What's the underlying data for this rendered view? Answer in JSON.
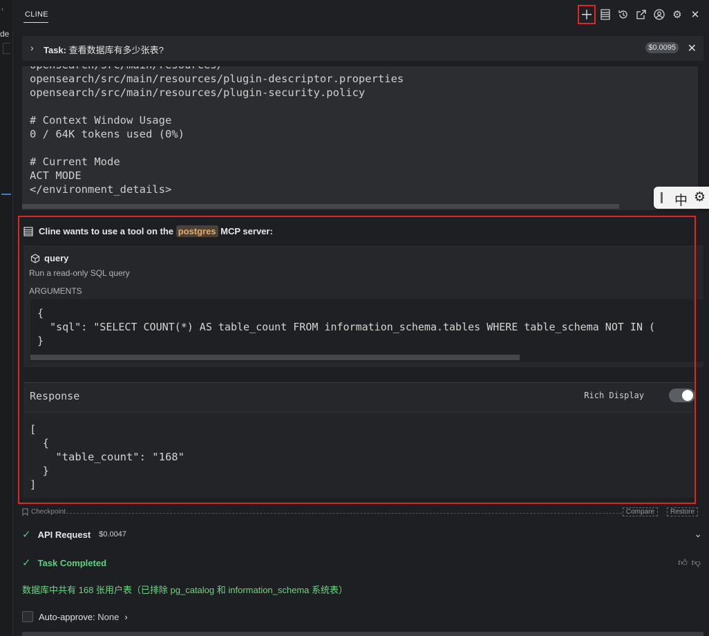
{
  "left_fragment": "de",
  "header": {
    "tab_title": "CLINE",
    "icons": [
      "plus-icon",
      "server-list-icon",
      "history-icon",
      "popout-icon",
      "account-icon",
      "gear-icon",
      "close-icon"
    ]
  },
  "task": {
    "prefix": "Task:",
    "text": "查看数据库有多少张表?",
    "cost": "$0.0095"
  },
  "environment_text": "opensearch/src/main/resources/\nopensearch/src/main/resources/plugin-descriptor.properties\nopensearch/src/main/resources/plugin-security.policy\n\n# Context Window Usage\n0 / 64K tokens used (0%)\n\n# Current Mode\nACT MODE\n</environment_details>",
  "ime": {
    "label": "中"
  },
  "tool": {
    "header_prefix": "Cline wants to use a tool on the",
    "server": "postgres",
    "header_suffix": "MCP server:",
    "name": "query",
    "description": "Run a read-only SQL query",
    "arguments_label": "ARGUMENTS",
    "arguments_code": "{\n  \"sql\": \"SELECT COUNT(*) AS table_count FROM information_schema.tables WHERE table_schema NOT IN (\n}",
    "response_title": "Response",
    "rich_display_label": "Rich Display",
    "rich_display_on": true,
    "response_code": "[\n  {\n    \"table_count\": \"168\"\n  }\n]"
  },
  "checkpoint": {
    "label": "Checkpoint",
    "compare": "Compare",
    "restore": "Restore"
  },
  "api_request": {
    "label": "API Request",
    "cost": "$0.0047"
  },
  "task_completed": {
    "label": "Task Completed"
  },
  "answer": "数据库中共有 168 张用户表（已排除 pg_catalog 和 information_schema 系统表）",
  "auto_approve": {
    "label": "Auto-approve:",
    "value": "None"
  },
  "colors": {
    "accent_green": "#4ec96b",
    "highlight_red": "#e0261f",
    "server_tag": "#e8a968"
  }
}
